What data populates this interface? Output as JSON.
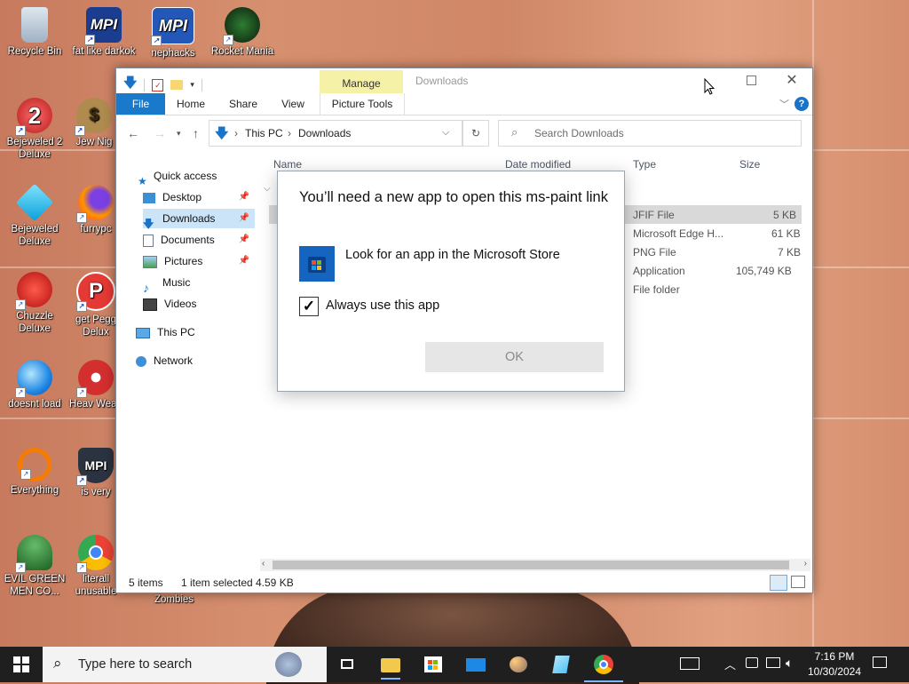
{
  "desktop": {
    "icons": [
      {
        "label": "Recycle Bin",
        "icon": "recycle-bin-icon"
      },
      {
        "label": "fat like darkok",
        "icon": "mpi-icon"
      },
      {
        "label": "nephacks",
        "icon": "mpi-icon"
      },
      {
        "label": "Rocket Mania",
        "icon": "rocket-icon"
      },
      {
        "label": "Bejeweled 2 Deluxe",
        "icon": "bejeweled2-icon"
      },
      {
        "label": "Jew Nig",
        "icon": "money-bag-icon"
      },
      {
        "label": "Bejeweled Deluxe",
        "icon": "diamond-icon"
      },
      {
        "label": "furrypc",
        "icon": "firefox-icon"
      },
      {
        "label": "Chuzzle Deluxe",
        "icon": "chuzzle-icon"
      },
      {
        "label": "get Pegg Delux",
        "icon": "peggle-icon"
      },
      {
        "label": "doesnt load",
        "icon": "thunderbird-icon"
      },
      {
        "label": "Heav Weap",
        "icon": "radiation-icon"
      },
      {
        "label": "Everything",
        "icon": "magnifier-icon"
      },
      {
        "label": "is very",
        "icon": "mpi-shield-icon"
      },
      {
        "label": "EVIL GREEN MEN CO...",
        "icon": "green-men-icon"
      },
      {
        "label": "literall unusable",
        "icon": "chrome-icon"
      },
      {
        "label": "Zombies",
        "icon": "zombies-icon"
      }
    ]
  },
  "explorer": {
    "title": "Downloads",
    "contextual_tab": "Manage",
    "ribbon_tabs": [
      "File",
      "Home",
      "Share",
      "View",
      "Picture Tools"
    ],
    "address": {
      "root": "This PC",
      "current": "Downloads"
    },
    "search_placeholder": "Search Downloads",
    "sidebar": [
      {
        "label": "Quick access"
      },
      {
        "label": "Desktop"
      },
      {
        "label": "Downloads"
      },
      {
        "label": "Documents"
      },
      {
        "label": "Pictures"
      },
      {
        "label": "Music"
      },
      {
        "label": "Videos"
      },
      {
        "label": "This PC"
      },
      {
        "label": "Network"
      }
    ],
    "columns": {
      "name": "Name",
      "date": "Date modified",
      "type": "Type",
      "size": "Size"
    },
    "rows": [
      {
        "type": "JFIF File",
        "size": "5 KB"
      },
      {
        "type": "Microsoft Edge H...",
        "size": "61 KB"
      },
      {
        "type": "PNG File",
        "size": "7 KB"
      },
      {
        "type": "Application",
        "size": "105,749 KB"
      },
      {
        "type": "File folder",
        "size": ""
      }
    ],
    "status": {
      "items": "5 items",
      "selected": "1 item selected",
      "size": "4.59 KB"
    }
  },
  "dialog": {
    "title": "You’ll need a new app to open this ms-paint link",
    "store_option": "Look for an app in the Microsoft Store",
    "always_use": "Always use this app",
    "always_use_checked": true,
    "ok_label": "OK"
  },
  "taskbar": {
    "search_placeholder": "Type here to search",
    "time": "7:16 PM",
    "date": "10/30/2024"
  },
  "colors": {
    "accent": "#1979ca",
    "manage_tab": "#f5f1a7",
    "taskbar": "#1f1f1f"
  }
}
